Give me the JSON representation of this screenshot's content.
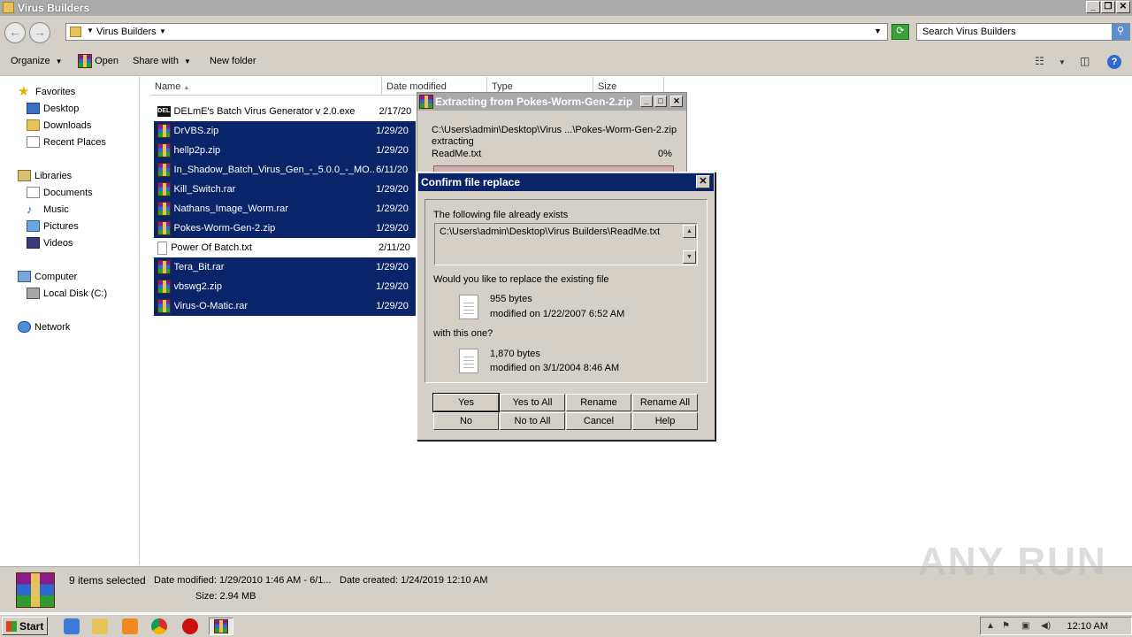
{
  "window": {
    "title": "Virus Builders"
  },
  "address": {
    "crumb": "Virus Builders",
    "search_placeholder": "Search Virus Builders"
  },
  "toolbar": {
    "organize": "Organize",
    "open": "Open",
    "share_with": "Share with",
    "new_folder": "New folder"
  },
  "nav": {
    "favorites": "Favorites",
    "desktop": "Desktop",
    "downloads": "Downloads",
    "recent": "Recent Places",
    "libraries": "Libraries",
    "documents": "Documents",
    "music": "Music",
    "pictures": "Pictures",
    "videos": "Videos",
    "computer": "Computer",
    "local_disk": "Local Disk (C:)",
    "network": "Network"
  },
  "columns": {
    "name": "Name",
    "date": "Date modified",
    "type": "Type",
    "size": "Size"
  },
  "files": [
    {
      "name": "DELmE's Batch Virus Generator v 2.0.exe",
      "date": "2/17/20",
      "icon": "exe-icon",
      "selected": false
    },
    {
      "name": "DrVBS.zip",
      "date": "1/29/20",
      "icon": "winrar-icon",
      "selected": true
    },
    {
      "name": "hellp2p.zip",
      "date": "1/29/20",
      "icon": "winrar-icon",
      "selected": true
    },
    {
      "name": "In_Shadow_Batch_Virus_Gen_-_5.0.0_-_MO...",
      "date": "6/11/20",
      "icon": "winrar-icon",
      "selected": true
    },
    {
      "name": "Kill_Switch.rar",
      "date": "1/29/20",
      "icon": "winrar-icon",
      "selected": true
    },
    {
      "name": "Nathans_Image_Worm.rar",
      "date": "1/29/20",
      "icon": "winrar-icon",
      "selected": true
    },
    {
      "name": "Pokes-Worm-Gen-2.zip",
      "date": "1/29/20",
      "icon": "winrar-icon",
      "selected": true
    },
    {
      "name": "Power Of Batch.txt",
      "date": "2/11/20",
      "icon": "text-file-icon",
      "selected": false
    },
    {
      "name": "Tera_Bit.rar",
      "date": "1/29/20",
      "icon": "winrar-icon",
      "selected": true
    },
    {
      "name": "vbswg2.zip",
      "date": "1/29/20",
      "icon": "winrar-icon",
      "selected": true
    },
    {
      "name": "Virus-O-Matic.rar",
      "date": "1/29/20",
      "icon": "winrar-icon",
      "selected": true
    }
  ],
  "details": {
    "count": "9 items selected",
    "modified": "Date modified: 1/29/2010 1:46 AM - 6/1...",
    "created": "Date created: 1/24/2019 12:10 AM",
    "size": "Size: 2.94 MB"
  },
  "extract_dialog": {
    "title": "Extracting from Pokes-Worm-Gen-2.zip",
    "path": "C:\\Users\\admin\\Desktop\\Virus ...\\Pokes-Worm-Gen-2.zip",
    "action": "extracting",
    "file": "ReadMe.txt",
    "percent": "0%",
    "progress": 0
  },
  "confirm_dialog": {
    "title": "Confirm file replace",
    "exists_label": "The following file already exists",
    "path": "C:\\Users\\admin\\Desktop\\Virus Builders\\ReadMe.txt",
    "question": "Would you like to replace the existing file",
    "existing_size": "955 bytes",
    "existing_modified": "modified on 1/22/2007 6:52 AM",
    "with_label": "with this one?",
    "new_size": "1,870 bytes",
    "new_modified": "modified on 3/1/2004 8:46 AM",
    "buttons": {
      "yes": "Yes",
      "yes_all": "Yes to All",
      "rename": "Rename",
      "rename_all": "Rename All",
      "no": "No",
      "no_all": "No to All",
      "cancel": "Cancel",
      "help": "Help"
    }
  },
  "taskbar": {
    "start": "Start",
    "clock": "12:10 AM"
  },
  "watermark": "ANY RUN"
}
